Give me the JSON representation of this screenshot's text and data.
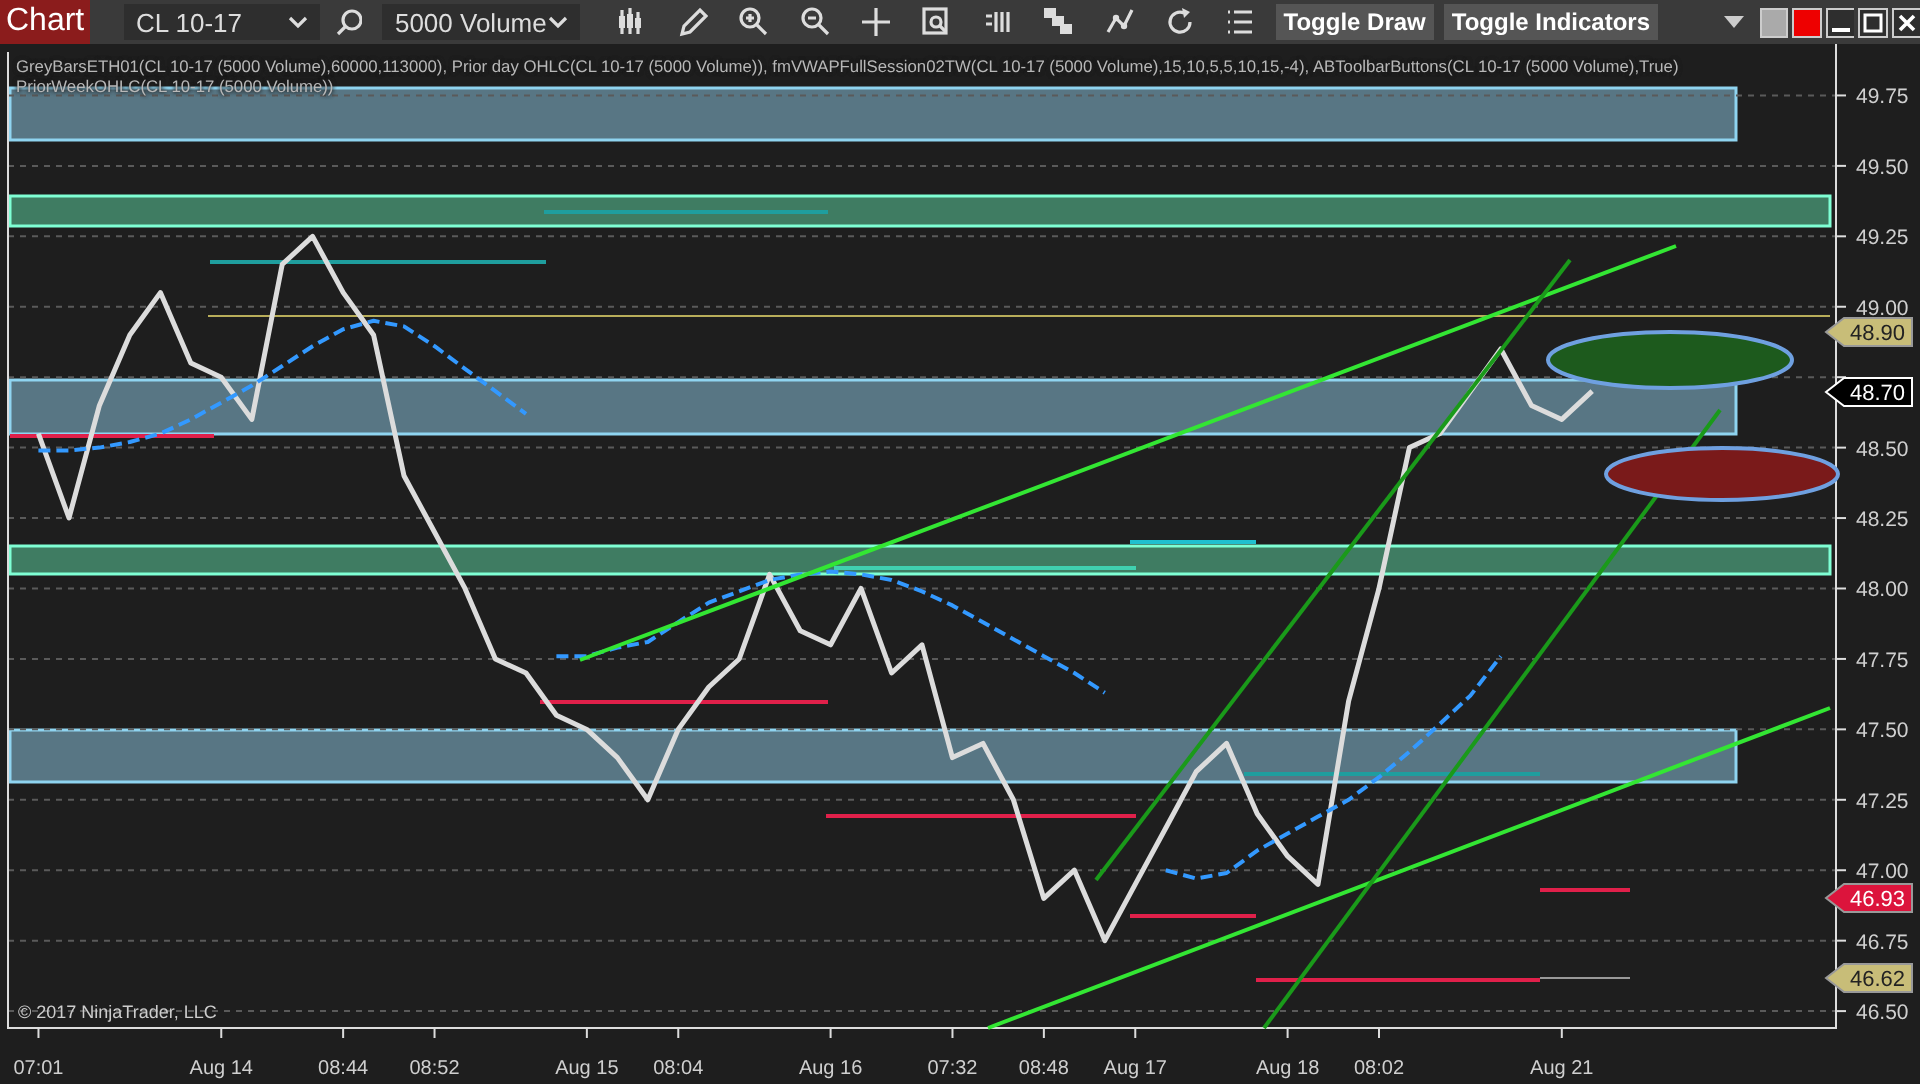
{
  "toolbar": {
    "tab": "Chart",
    "instrument": "CL 10-17",
    "interval": "5000 Volume",
    "buttons": [
      "Toggle Draw",
      "Toggle Indicators"
    ]
  },
  "chart": {
    "indicator_labels": [
      "GreyBarsETH01(CL 10-17 (5000 Volume),60000,113000), Prior day OHLC(CL 10-17 (5000 Volume)), fmVWAPFullSession02TW(CL 10-17 (5000 Volume),15,10,5,5,10,15,-4), ABToolbarButtons(CL 10-17 (5000 Volume),True)",
      "PriorWeekOHLC(CL 10-17 (5000 Volume))"
    ],
    "copyright": "© 2017 NinjaTrader, LLC",
    "price_markers": [
      {
        "text": "48.90",
        "color": "#c8bd78"
      },
      {
        "text": "48.70",
        "color": "#000000"
      },
      {
        "text": "46.93",
        "color": "#dc143c"
      },
      {
        "text": "46.62",
        "color": "#c8bd78"
      }
    ],
    "chart_data": {
      "type": "line",
      "categories": [
        "07:01",
        null,
        null,
        null,
        null,
        null,
        "Aug 14",
        null,
        null,
        null,
        "08:44",
        null,
        null,
        "08:52",
        null,
        null,
        null,
        null,
        "Aug 15",
        null,
        null,
        "08:04",
        null,
        null,
        null,
        null,
        "Aug 16",
        null,
        null,
        null,
        "07:32",
        null,
        null,
        "08:48",
        null,
        null,
        "Aug 17",
        null,
        null,
        null,
        null,
        "Aug 18",
        null,
        null,
        "08:02",
        null,
        null,
        null,
        null,
        null,
        "Aug 21",
        null
      ],
      "grid": true,
      "series": [
        {
          "color": "#dcdcdc",
          "line_style": "solid",
          "values": [
            48.55,
            48.25,
            48.65,
            48.9,
            49.05,
            48.8,
            48.75,
            48.6,
            49.15,
            49.25,
            49.05,
            48.9,
            48.4,
            48.2,
            48.0,
            47.75,
            47.7,
            47.55,
            47.5,
            47.4,
            47.25,
            47.5,
            47.65,
            47.75,
            48.05,
            47.85,
            47.8,
            48.0,
            47.7,
            47.8,
            47.4,
            47.45,
            47.25,
            46.9,
            47.0,
            46.75,
            46.95,
            47.15,
            47.35,
            47.45,
            47.2,
            47.05,
            46.95,
            47.6,
            48.0,
            48.5,
            48.55,
            48.7,
            48.85,
            48.65,
            48.6,
            48.7
          ]
        },
        {
          "color": "#3399ff",
          "line_style": "dashed",
          "values": [
            48.49,
            48.49,
            48.5,
            48.52,
            48.55,
            48.6,
            48.66,
            48.72,
            48.79,
            48.86,
            48.92,
            48.95,
            48.93,
            48.86,
            48.78,
            48.7,
            48.62,
            47.76,
            47.76,
            47.79,
            47.81,
            47.88,
            47.95,
            47.99,
            48.03,
            48.05,
            48.06,
            48.05,
            48.03,
            47.99,
            47.94,
            47.88,
            47.82,
            47.76,
            47.7,
            47.63,
            null,
            47.0,
            46.97,
            46.99,
            47.07,
            47.13,
            47.19,
            47.25,
            47.33,
            47.42,
            47.52,
            47.62,
            47.76,
            null,
            null,
            null
          ]
        }
      ],
      "ylim": [
        46.44,
        49.89
      ],
      "yticks": [
        {
          "value": 46.5,
          "label": "46.50"
        },
        {
          "value": 46.75,
          "label": "46.75"
        },
        {
          "value": 47,
          "label": "47.00"
        },
        {
          "value": 47.25,
          "label": "47.25"
        },
        {
          "value": 47.5,
          "label": "47.50"
        },
        {
          "value": 47.75,
          "label": "47.75"
        },
        {
          "value": 48,
          "label": "48.00"
        },
        {
          "value": 48.25,
          "label": "48.25"
        },
        {
          "value": 48.5,
          "label": "48.50"
        },
        {
          "value": 49,
          "label": "49.00"
        },
        {
          "value": 49.25,
          "label": "49.25"
        },
        {
          "value": 49.5,
          "label": "49.50"
        },
        {
          "value": 49.75,
          "label": "49.75"
        }
      ]
    }
  }
}
